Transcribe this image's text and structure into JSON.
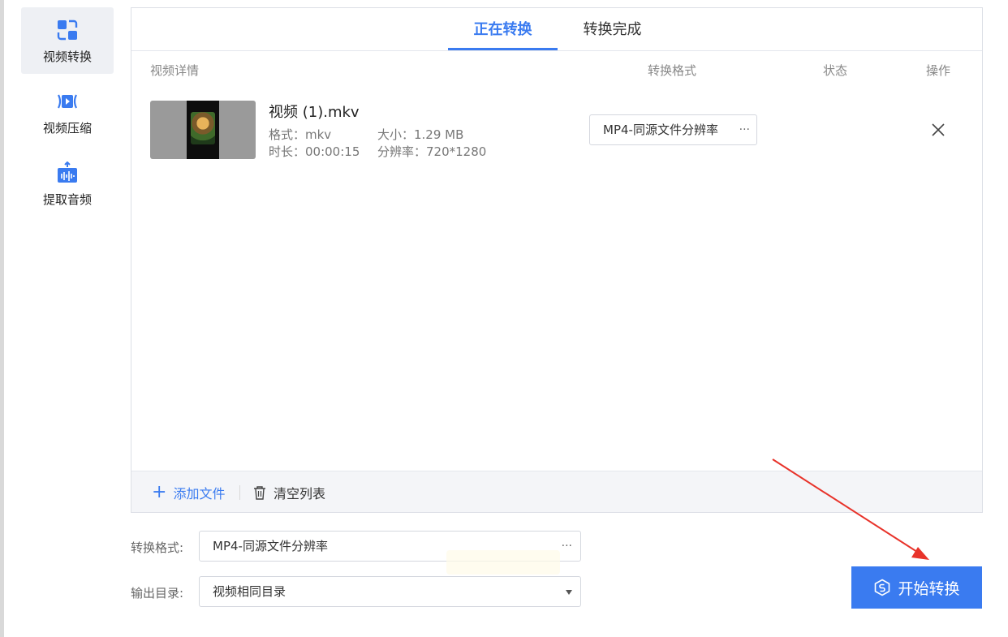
{
  "sidebar": {
    "items": [
      {
        "label": "视频转换",
        "icon": "convert-icon",
        "active": true
      },
      {
        "label": "视频压缩",
        "icon": "compress-icon",
        "active": false
      },
      {
        "label": "提取音频",
        "icon": "extract-audio-icon",
        "active": false
      }
    ]
  },
  "tabs": [
    {
      "label": "正在转换",
      "active": true
    },
    {
      "label": "转换完成",
      "active": false
    }
  ],
  "columns": {
    "details": "视频详情",
    "format": "转换格式",
    "status": "状态",
    "actions": "操作"
  },
  "file": {
    "name": "视频 (1).mkv",
    "format_text": "格式：mkv",
    "size_text": "大小：1.29 MB",
    "duration_text": "时长：00:00:15",
    "resolution_text": "分辨率：720*1280",
    "output_format": "MP4-同源文件分辨率",
    "more": "···"
  },
  "footer": {
    "add_file": "添加文件",
    "clear_list": "清空列表"
  },
  "form": {
    "format_label": "转换格式:",
    "format_value": "MP4-同源文件分辨率",
    "format_more": "···",
    "output_label": "输出目录:",
    "output_value": "视频相同目录"
  },
  "start_button": {
    "label": "开始转换"
  },
  "colors": {
    "accent": "#3a7bf0",
    "annotation_arrow": "#e8332a",
    "sidebar_active_bg": "#eef0f4"
  }
}
